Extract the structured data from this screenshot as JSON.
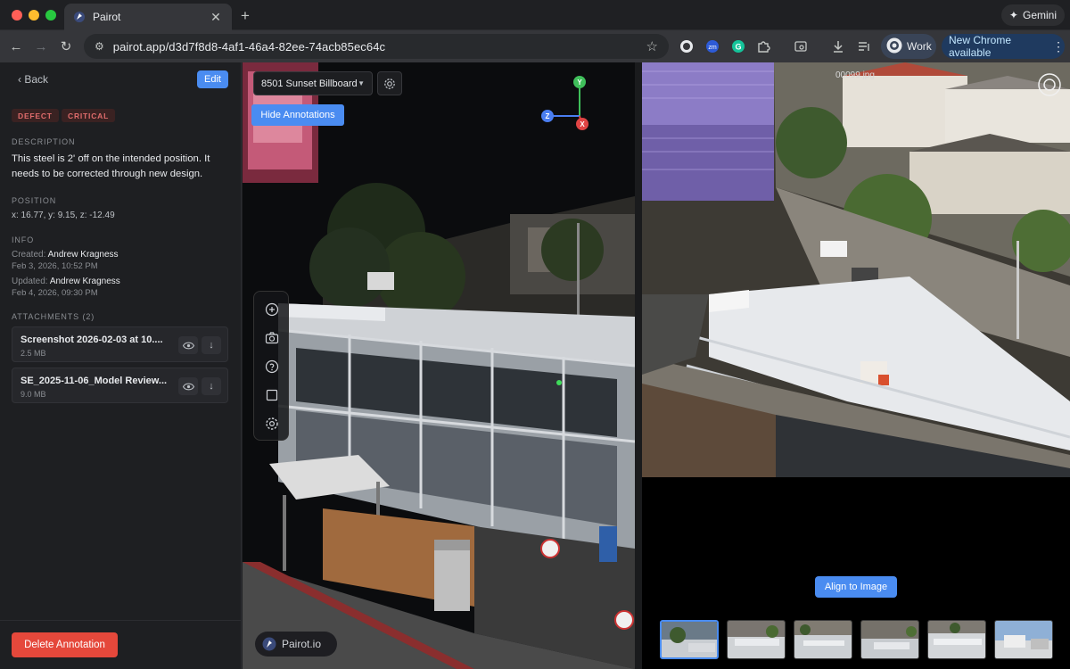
{
  "browser": {
    "tab_title": "Pairot",
    "tab_close": "✕",
    "new_tab": "+",
    "gemini_label": "Gemini",
    "url": "pairot.app/d3d7f8d8-4af1-46a4-82ee-74acb85ec64c",
    "work_label": "Work",
    "update_label": "New Chrome available",
    "menu": "⋮",
    "back_arrow": "←",
    "forward_arrow": "→",
    "reload": "↻"
  },
  "sidebar": {
    "back_label": "‹ Back",
    "edit_label": "Edit",
    "badges": [
      "DEFECT",
      "CRITICAL"
    ],
    "description_heading": "DESCRIPTION",
    "description_text": "This steel is 2' off on the intended position. It needs to be corrected through new design.",
    "position_heading": "POSITION",
    "position_text": "x: 16.77, y: 9.15, z: -12.49",
    "info_heading": "INFO",
    "created_label": "Created:",
    "created_by": "Andrew Kragness",
    "created_date": "Feb 3, 2026, 10:52 PM",
    "updated_label": "Updated:",
    "updated_by": "Andrew Kragness",
    "updated_date": "Feb 4, 2026, 09:30 PM",
    "attachments_heading": "ATTACHMENTS (2)",
    "attachments": [
      {
        "name": "Screenshot 2026-02-03 at 10....",
        "size": "2.5 MB"
      },
      {
        "name": "SE_2025-11-06_Model Review...",
        "size": "9.0 MB"
      }
    ],
    "delete_label": "Delete Annotation"
  },
  "viewer": {
    "site_name": "8501 Sunset Billboard",
    "hide_label": "Hide Annotations",
    "axis_labels": {
      "y": "Y",
      "z": "Z",
      "x": "X"
    },
    "brand_label": "Pairot.io",
    "tools": [
      "add-icon",
      "camera-icon",
      "help-icon",
      "square-icon",
      "settings-icon"
    ]
  },
  "photo": {
    "filename": "00099.jpg",
    "align_label": "Align to Image",
    "thumbnail_count": 6,
    "selected_thumbnail": 0
  },
  "colors": {
    "accent": "#4a8cf1",
    "danger": "#e5483b",
    "badge_text": "#e06c6c"
  }
}
